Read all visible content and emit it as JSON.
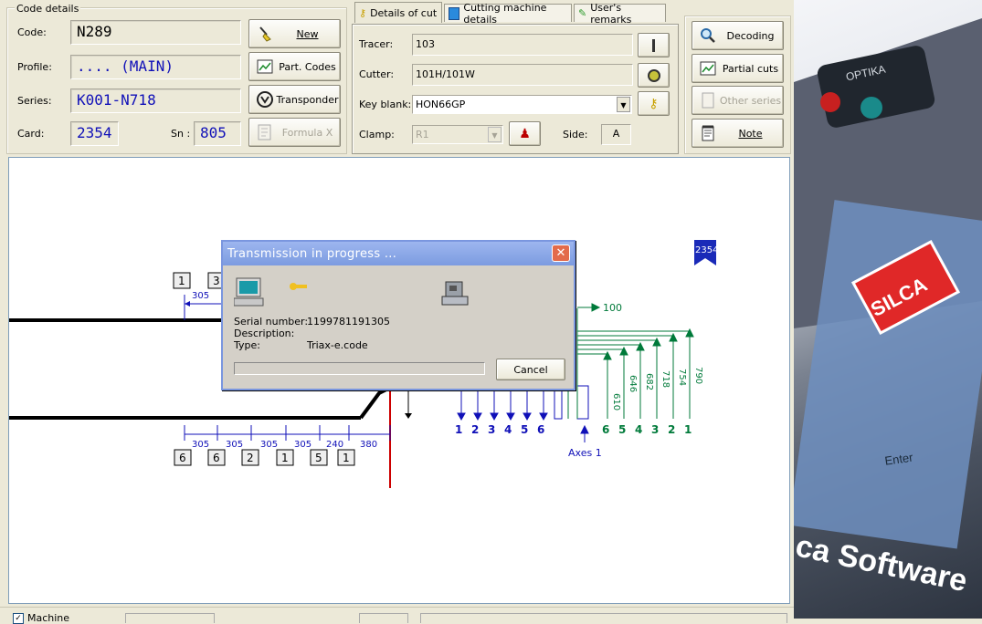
{
  "code_details": {
    "group_title": "Code details",
    "code_label": "Code:",
    "code_value": "N289",
    "profile_label": "Profile:",
    "profile_value": ".... (MAIN)",
    "series_label": "Series:",
    "series_value": "K001-N718",
    "card_label": "Card:",
    "card_value": "2354",
    "sn_label": "Sn :",
    "sn_value": "805"
  },
  "left_buttons": {
    "new": "New",
    "part_codes": "Part. Codes",
    "transponder": "Transponder",
    "formula": "Formula X"
  },
  "tabs": [
    {
      "label": "Details of cut"
    },
    {
      "label": "Cutting machine details"
    },
    {
      "label": "User's remarks"
    }
  ],
  "details": {
    "tracer_label": "Tracer:",
    "tracer_value": "103",
    "cutter_label": "Cutter:",
    "cutter_value": "101H/101W",
    "key_blank_label": "Key blank:",
    "key_blank_value": "HON66GP",
    "clamp_label": "Clamp:",
    "clamp_value": "R1",
    "side_label": "Side:",
    "side_value": "A"
  },
  "right_buttons": {
    "decoding": "Decoding",
    "partial_cuts": "Partial cuts",
    "other_series": "Other series",
    "note": "Note"
  },
  "diagram": {
    "top_boxes": [
      "1",
      "3"
    ],
    "top_dim": "305",
    "bottom_boxes": [
      "6",
      "6",
      "2",
      "1",
      "5",
      "1"
    ],
    "bottom_dims": [
      "305",
      "305",
      "305",
      "305",
      "240",
      "380"
    ],
    "axis_numbers_blue": [
      "1",
      "2",
      "3",
      "4",
      "5",
      "6"
    ],
    "axis_numbers_green": [
      "6",
      "5",
      "4",
      "3",
      "2",
      "1"
    ],
    "green_dims": [
      "610",
      "646",
      "682",
      "718",
      "754",
      "790"
    ],
    "top_offset": "100",
    "axes_label": "Axes 1",
    "card_tag": "2354"
  },
  "dialog": {
    "title": "Transmission in progress ...",
    "serial_label": "Serial number:",
    "serial_value": "1199781191305",
    "description_label": "Description:",
    "description_value": "",
    "type_label": "Type:",
    "type_value": "Triax-e.code",
    "cancel": "Cancel",
    "progress": 0
  },
  "bottom": {
    "machine_label": "Machine"
  },
  "promo": {
    "brand": "SILCA",
    "device": "OPTIKA",
    "software": "ca Software",
    "enter": "Enter"
  },
  "colors": {
    "blue": "#1010b8",
    "green": "#007a3a",
    "red": "#cc0000"
  }
}
